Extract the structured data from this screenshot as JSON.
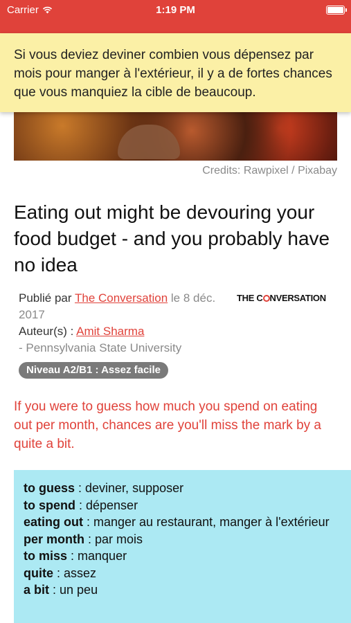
{
  "status": {
    "carrier": "Carrier",
    "time": "1:19 PM"
  },
  "banner": {
    "text": "Si vous deviez deviner combien vous dépensez par mois pour manger à l'extérieur, il y a de fortes chances que vous manquiez la cible de beaucoup."
  },
  "image": {
    "credits": "Credits: Rawpixel / Pixabay"
  },
  "article": {
    "title": "Eating out might be devouring your food budget - and you probably have no idea",
    "published_label": "Publié par",
    "publisher": "The Conversation",
    "date": "le 8 déc. 2017",
    "author_label": "Auteur(s) :",
    "author": "Amit Sharma",
    "affiliation": "- Pennsylvania State University",
    "brand_logo_left": "THE C",
    "brand_logo_right": "NVERSATION",
    "level": "Niveau A2/B1 : Assez facile",
    "english_text": "If you were to guess how much you spend on eating out per month, chances are you'll miss the mark by a quite a bit."
  },
  "vocab": [
    {
      "term": "to guess",
      "definition": " : deviner, supposer"
    },
    {
      "term": "to spend",
      "definition": " : dépenser"
    },
    {
      "term": "eating out",
      "definition": " : manger au restaurant, manger à l'extérieur"
    },
    {
      "term": "per month",
      "definition": " : par mois"
    },
    {
      "term": "to miss",
      "definition": " : manquer"
    },
    {
      "term": "quite",
      "definition": " : assez"
    },
    {
      "term": "a bit",
      "definition": " : un peu"
    }
  ],
  "colors": {
    "accent": "#e0423a",
    "banner_bg": "#fbf0a6",
    "vocab_bg": "#ace9f3",
    "badge_bg": "#7a7a7a"
  }
}
